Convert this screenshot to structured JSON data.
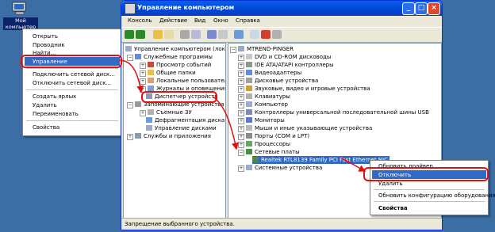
{
  "desktop": {
    "icon_label": "Мой компьютер"
  },
  "context_menu": {
    "items": [
      "Открыть",
      "Проводник",
      "Найти...",
      "Управление",
      "Подключить сетевой диск...",
      "Отключить сетевой диск...",
      "Создать ярлык",
      "Удалить",
      "Переименовать",
      "Свойства"
    ],
    "selected": "Управление"
  },
  "window": {
    "title": "Управление компьютером",
    "menu": [
      "Консоль",
      "Действие",
      "Вид",
      "Окно",
      "Справка"
    ],
    "tree": [
      "Управление компьютером (локал",
      "Служебные программы",
      "Просмотр событий",
      "Общие папки",
      "Локальные пользователи",
      "Журналы и оповещения пр",
      "Диспетчер устройств",
      "Запоминающие устройства",
      "Съемные ЗУ",
      "Дефрагментация диска",
      "Управление дисками",
      "Службы и приложения"
    ],
    "devices": [
      "MTREND-PINGER",
      "DVD и CD-ROM дисководы",
      "IDE ATA/ATAPI контроллеры",
      "Видеоадаптеры",
      "Дисковые устройства",
      "Звуковые, видео и игровые устройства",
      "Клавиатуры",
      "Компьютер",
      "Контроллеры универсальной последовательной шины USB",
      "Мониторы",
      "Мыши и иные указывающие устройства",
      "Порты (COM и LPT)",
      "Процессоры",
      "Сетевые платы",
      "Realtek RTL8139 Family PCI Fast Ethernet NIC",
      "Системные устройства"
    ],
    "status": "Запрещение выбранного устройства."
  },
  "device_menu": {
    "items": [
      "Обновить драйвер...",
      "Отключить",
      "Удалить",
      "Обновить конфигурацию оборудования",
      "Свойства"
    ],
    "selected": "Отключить"
  },
  "colors": {
    "desktop": "#3a6ea5",
    "selection": "#316ac5",
    "highlight": "#e01010"
  }
}
